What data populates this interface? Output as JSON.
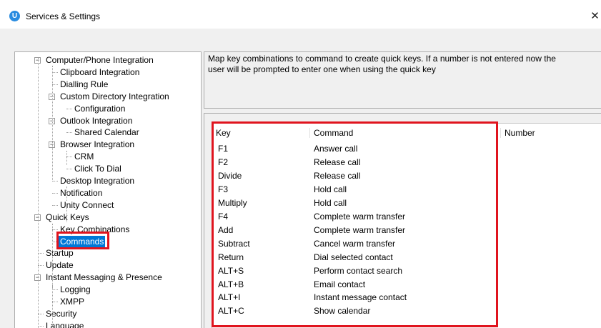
{
  "window": {
    "title": "Services & Settings",
    "icon_letter": "U",
    "close_glyph": "✕"
  },
  "tree": {
    "expanded_glyph": "−",
    "scroll_up_glyph": "▲",
    "items": [
      {
        "label": "Computer/Phone Integration",
        "expanded": true
      },
      {
        "label": "Clipboard Integration"
      },
      {
        "label": "Dialling Rule"
      },
      {
        "label": "Custom Directory Integration",
        "expanded": true
      },
      {
        "label": "Configuration"
      },
      {
        "label": "Outlook Integration",
        "expanded": true
      },
      {
        "label": "Shared Calendar"
      },
      {
        "label": "Browser Integration",
        "expanded": true
      },
      {
        "label": "CRM"
      },
      {
        "label": "Click To Dial"
      },
      {
        "label": "Desktop Integration"
      },
      {
        "label": "Notification"
      },
      {
        "label": "Unity Connect"
      },
      {
        "label": "Quick Keys",
        "expanded": true
      },
      {
        "label": "Key Combinations"
      },
      {
        "label": "Commands",
        "selected": true
      },
      {
        "label": "Startup"
      },
      {
        "label": "Update"
      },
      {
        "label": "Instant Messaging & Presence",
        "expanded": true
      },
      {
        "label": "Logging"
      },
      {
        "label": "XMPP"
      },
      {
        "label": "Security"
      },
      {
        "label": "Language"
      }
    ]
  },
  "description": {
    "line1": "Map key combinations to command to create quick keys.  If a number is not entered now the",
    "line2": "user will be prompted to enter one when using the quick key"
  },
  "grid": {
    "headers": {
      "key": "Key",
      "command": "Command",
      "number": "Number"
    },
    "rows": [
      {
        "key": "F1",
        "command": "Answer call",
        "number": ""
      },
      {
        "key": "F2",
        "command": "Release call",
        "number": ""
      },
      {
        "key": "Divide",
        "command": "Release call",
        "number": ""
      },
      {
        "key": "F3",
        "command": "Hold call",
        "number": ""
      },
      {
        "key": "Multiply",
        "command": "Hold call",
        "number": ""
      },
      {
        "key": "F4",
        "command": "Complete warm transfer",
        "number": ""
      },
      {
        "key": "Add",
        "command": "Complete warm transfer",
        "number": ""
      },
      {
        "key": "Subtract",
        "command": "Cancel warm transfer",
        "number": ""
      },
      {
        "key": "Return",
        "command": "Dial selected contact",
        "number": ""
      },
      {
        "key": "ALT+S",
        "command": "Perform contact search",
        "number": ""
      },
      {
        "key": "ALT+B",
        "command": "Email contact",
        "number": ""
      },
      {
        "key": "ALT+I",
        "command": "Instant message contact",
        "number": ""
      },
      {
        "key": "ALT+C",
        "command": "Show calendar",
        "number": ""
      }
    ]
  },
  "colors": {
    "annotation": "#e0141e",
    "selection": "#0078d7",
    "app_icon": "#2a8ce0"
  }
}
